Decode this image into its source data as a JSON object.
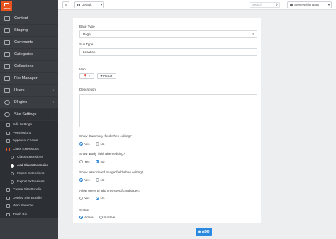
{
  "brand": {
    "logo_text": "mura"
  },
  "sidebar": {
    "items": [
      {
        "label": "Content",
        "icon": "content-icon"
      },
      {
        "label": "Staging",
        "icon": "staging-icon"
      },
      {
        "label": "Comments",
        "icon": "comments-icon"
      },
      {
        "label": "Categories",
        "icon": "categories-icon"
      },
      {
        "label": "Collections",
        "icon": "collections-icon"
      },
      {
        "label": "File Manager",
        "icon": "file-manager-icon"
      },
      {
        "label": "Users",
        "icon": "users-icon",
        "chevron": "›"
      },
      {
        "label": "Plugins",
        "icon": "plugins-icon",
        "chevron": "›"
      },
      {
        "label": "Site Settings",
        "icon": "site-settings-icon",
        "chevron": "⌄"
      }
    ],
    "site_settings_items": [
      {
        "label": "Edit Settings"
      },
      {
        "label": "Permissions"
      },
      {
        "label": "Approval Chains"
      },
      {
        "label": "Class Extensions"
      },
      {
        "label": "Class Extensions"
      },
      {
        "label": "Add Class Extension"
      },
      {
        "label": "Import Extensions"
      },
      {
        "label": "Export Extensions"
      },
      {
        "label": "Create Site Bundle"
      },
      {
        "label": "Deploy Site Bundle"
      },
      {
        "label": "Web Services"
      },
      {
        "label": "Trash Bin"
      }
    ]
  },
  "topbar": {
    "menu_glyph": "≡",
    "site_select": "Default",
    "search_placeholder": "Search",
    "user_name": "Steve Withington"
  },
  "form": {
    "base_type_label": "Base Type",
    "base_type_value": "Page",
    "sub_type_label": "Sub Type",
    "sub_type_value": "Location",
    "icon_label": "Icon",
    "reset_label": "Reset",
    "description_label": "Description",
    "summary_label": "Show 'Summary' field when editing?",
    "body_label": "Show 'Body' field when editing?",
    "image_label": "Show 'Associated Image' field when editing?",
    "subtypes_label": "Allow users to add only specific subtypes?",
    "status_label": "Status",
    "yes": "Yes",
    "no": "No",
    "active": "Active",
    "inactive": "Inactive",
    "summary_selected": "Yes",
    "body_selected": "No",
    "image_selected": "Yes",
    "subtypes_selected": "No",
    "status_selected": "Active"
  },
  "add_button_label": "ADD"
}
